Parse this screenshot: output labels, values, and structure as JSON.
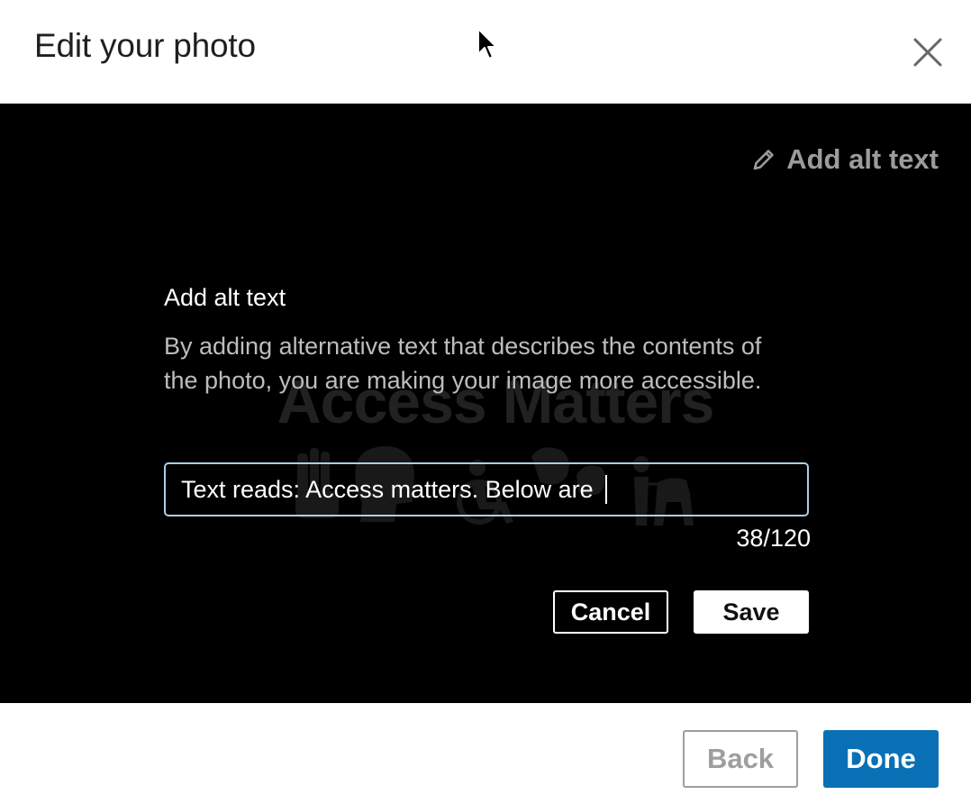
{
  "header": {
    "title": "Edit your photo",
    "close_icon": "close-icon"
  },
  "stage": {
    "add_alt_link_label": "Add alt text",
    "add_alt_link_icon": "pencil-icon",
    "watermark_text": "Access Matters"
  },
  "alt_text_panel": {
    "heading": "Add alt text",
    "description": "By adding alternative text that describes the contents of the photo, you are making your image more accessible.",
    "input_value": "Text reads: Access matters. Below are ",
    "char_count": "38/120",
    "cancel_label": "Cancel",
    "save_label": "Save"
  },
  "footer": {
    "back_label": "Back",
    "done_label": "Done"
  },
  "colors": {
    "stage_background": "#000000",
    "primary_button": "#0a70b5",
    "input_focus_border": "#a8d0ea",
    "muted_text": "#9e9e9e"
  }
}
